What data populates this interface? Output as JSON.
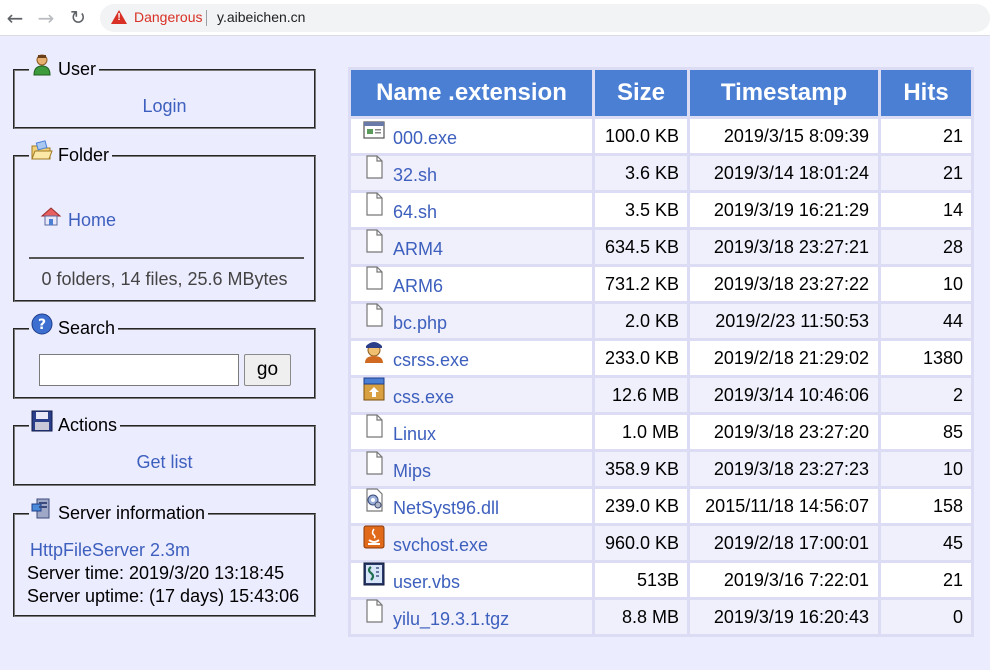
{
  "browser": {
    "back_icon": "←",
    "forward_icon": "→",
    "reload_icon": "↻",
    "security_label": "Dangerous",
    "url": "y.aibeichen.cn"
  },
  "user_panel": {
    "title": "User",
    "login_label": "Login"
  },
  "folder_panel": {
    "title": "Folder",
    "home_label": "Home",
    "stats": "0 folders, 14 files, 25.6 MBytes"
  },
  "search_panel": {
    "title": "Search",
    "query": "",
    "go_label": "go"
  },
  "actions_panel": {
    "title": "Actions",
    "get_list_label": "Get list"
  },
  "server_panel": {
    "title": "Server information",
    "software_link": "HttpFileServer 2.3m",
    "server_time": "Server time: 2019/3/20 13:18:45",
    "server_uptime": "Server uptime: (17 days) 15:43:06"
  },
  "table": {
    "headers": {
      "name": "Name .extension",
      "size": "Size",
      "timestamp": "Timestamp",
      "hits": "Hits"
    },
    "rows": [
      {
        "name": "000.exe",
        "size": "100.0 KB",
        "timestamp": "2019/3/15 8:09:39",
        "hits": "21",
        "icon": "exe-window-icon"
      },
      {
        "name": "32.sh",
        "size": "3.6 KB",
        "timestamp": "2019/3/14 18:01:24",
        "hits": "21",
        "icon": "file-icon"
      },
      {
        "name": "64.sh",
        "size": "3.5 KB",
        "timestamp": "2019/3/19 16:21:29",
        "hits": "14",
        "icon": "file-icon"
      },
      {
        "name": "ARM4",
        "size": "634.5 KB",
        "timestamp": "2019/3/18 23:27:21",
        "hits": "28",
        "icon": "file-icon"
      },
      {
        "name": "ARM6",
        "size": "731.2 KB",
        "timestamp": "2019/3/18 23:27:22",
        "hits": "10",
        "icon": "file-icon"
      },
      {
        "name": "bc.php",
        "size": "2.0 KB",
        "timestamp": "2019/2/23 11:50:53",
        "hits": "44",
        "icon": "file-icon"
      },
      {
        "name": "csrss.exe",
        "size": "233.0 KB",
        "timestamp": "2019/2/18 21:29:02",
        "hits": "1380",
        "icon": "person-icon"
      },
      {
        "name": "css.exe",
        "size": "12.6 MB",
        "timestamp": "2019/3/14 10:46:06",
        "hits": "2",
        "icon": "installer-box-icon"
      },
      {
        "name": "Linux",
        "size": "1.0 MB",
        "timestamp": "2019/3/18 23:27:20",
        "hits": "85",
        "icon": "file-icon"
      },
      {
        "name": "Mips",
        "size": "358.9 KB",
        "timestamp": "2019/3/18 23:27:23",
        "hits": "10",
        "icon": "file-icon"
      },
      {
        "name": "NetSyst96.dll",
        "size": "239.0 KB",
        "timestamp": "2015/11/18 14:56:07",
        "hits": "158",
        "icon": "dll-gear-icon"
      },
      {
        "name": "svchost.exe",
        "size": "960.0 KB",
        "timestamp": "2019/2/18 17:00:01",
        "hits": "45",
        "icon": "java-icon"
      },
      {
        "name": "user.vbs",
        "size": "513B",
        "timestamp": "2019/3/16 7:22:01",
        "hits": "21",
        "icon": "script-icon"
      },
      {
        "name": "yilu_19.3.1.tgz",
        "size": "8.8 MB",
        "timestamp": "2019/3/19 16:20:43",
        "hits": "0",
        "icon": "file-icon"
      }
    ]
  },
  "colors": {
    "page_bg": "#ececff",
    "header_bg": "#4a7fd4",
    "link": "#3d5fbd",
    "danger": "#d93025"
  }
}
